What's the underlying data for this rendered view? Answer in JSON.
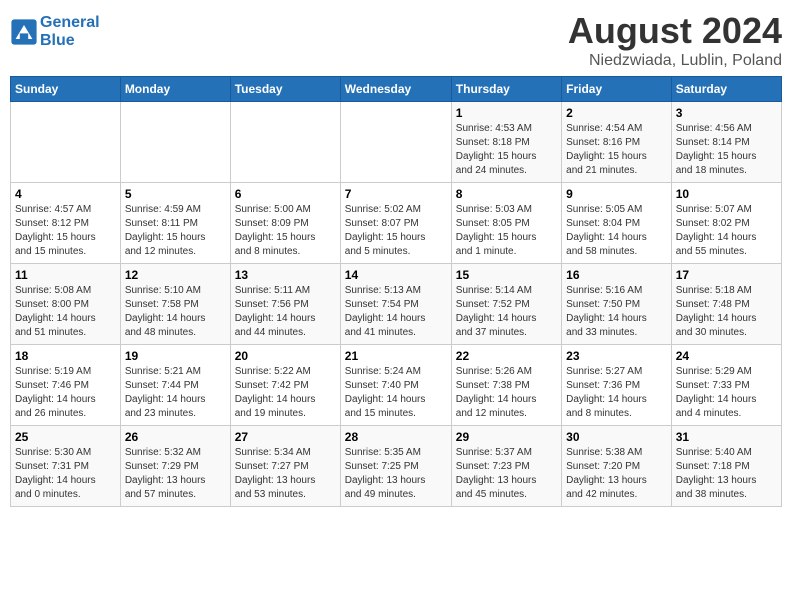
{
  "logo": {
    "line1": "General",
    "line2": "Blue"
  },
  "title": "August 2024",
  "subtitle": "Niedzwiada, Lublin, Poland",
  "header_days": [
    "Sunday",
    "Monday",
    "Tuesday",
    "Wednesday",
    "Thursday",
    "Friday",
    "Saturday"
  ],
  "weeks": [
    [
      {
        "num": "",
        "info": ""
      },
      {
        "num": "",
        "info": ""
      },
      {
        "num": "",
        "info": ""
      },
      {
        "num": "",
        "info": ""
      },
      {
        "num": "1",
        "info": "Sunrise: 4:53 AM\nSunset: 8:18 PM\nDaylight: 15 hours\nand 24 minutes."
      },
      {
        "num": "2",
        "info": "Sunrise: 4:54 AM\nSunset: 8:16 PM\nDaylight: 15 hours\nand 21 minutes."
      },
      {
        "num": "3",
        "info": "Sunrise: 4:56 AM\nSunset: 8:14 PM\nDaylight: 15 hours\nand 18 minutes."
      }
    ],
    [
      {
        "num": "4",
        "info": "Sunrise: 4:57 AM\nSunset: 8:12 PM\nDaylight: 15 hours\nand 15 minutes."
      },
      {
        "num": "5",
        "info": "Sunrise: 4:59 AM\nSunset: 8:11 PM\nDaylight: 15 hours\nand 12 minutes."
      },
      {
        "num": "6",
        "info": "Sunrise: 5:00 AM\nSunset: 8:09 PM\nDaylight: 15 hours\nand 8 minutes."
      },
      {
        "num": "7",
        "info": "Sunrise: 5:02 AM\nSunset: 8:07 PM\nDaylight: 15 hours\nand 5 minutes."
      },
      {
        "num": "8",
        "info": "Sunrise: 5:03 AM\nSunset: 8:05 PM\nDaylight: 15 hours\nand 1 minute."
      },
      {
        "num": "9",
        "info": "Sunrise: 5:05 AM\nSunset: 8:04 PM\nDaylight: 14 hours\nand 58 minutes."
      },
      {
        "num": "10",
        "info": "Sunrise: 5:07 AM\nSunset: 8:02 PM\nDaylight: 14 hours\nand 55 minutes."
      }
    ],
    [
      {
        "num": "11",
        "info": "Sunrise: 5:08 AM\nSunset: 8:00 PM\nDaylight: 14 hours\nand 51 minutes."
      },
      {
        "num": "12",
        "info": "Sunrise: 5:10 AM\nSunset: 7:58 PM\nDaylight: 14 hours\nand 48 minutes."
      },
      {
        "num": "13",
        "info": "Sunrise: 5:11 AM\nSunset: 7:56 PM\nDaylight: 14 hours\nand 44 minutes."
      },
      {
        "num": "14",
        "info": "Sunrise: 5:13 AM\nSunset: 7:54 PM\nDaylight: 14 hours\nand 41 minutes."
      },
      {
        "num": "15",
        "info": "Sunrise: 5:14 AM\nSunset: 7:52 PM\nDaylight: 14 hours\nand 37 minutes."
      },
      {
        "num": "16",
        "info": "Sunrise: 5:16 AM\nSunset: 7:50 PM\nDaylight: 14 hours\nand 33 minutes."
      },
      {
        "num": "17",
        "info": "Sunrise: 5:18 AM\nSunset: 7:48 PM\nDaylight: 14 hours\nand 30 minutes."
      }
    ],
    [
      {
        "num": "18",
        "info": "Sunrise: 5:19 AM\nSunset: 7:46 PM\nDaylight: 14 hours\nand 26 minutes."
      },
      {
        "num": "19",
        "info": "Sunrise: 5:21 AM\nSunset: 7:44 PM\nDaylight: 14 hours\nand 23 minutes."
      },
      {
        "num": "20",
        "info": "Sunrise: 5:22 AM\nSunset: 7:42 PM\nDaylight: 14 hours\nand 19 minutes."
      },
      {
        "num": "21",
        "info": "Sunrise: 5:24 AM\nSunset: 7:40 PM\nDaylight: 14 hours\nand 15 minutes."
      },
      {
        "num": "22",
        "info": "Sunrise: 5:26 AM\nSunset: 7:38 PM\nDaylight: 14 hours\nand 12 minutes."
      },
      {
        "num": "23",
        "info": "Sunrise: 5:27 AM\nSunset: 7:36 PM\nDaylight: 14 hours\nand 8 minutes."
      },
      {
        "num": "24",
        "info": "Sunrise: 5:29 AM\nSunset: 7:33 PM\nDaylight: 14 hours\nand 4 minutes."
      }
    ],
    [
      {
        "num": "25",
        "info": "Sunrise: 5:30 AM\nSunset: 7:31 PM\nDaylight: 14 hours\nand 0 minutes."
      },
      {
        "num": "26",
        "info": "Sunrise: 5:32 AM\nSunset: 7:29 PM\nDaylight: 13 hours\nand 57 minutes."
      },
      {
        "num": "27",
        "info": "Sunrise: 5:34 AM\nSunset: 7:27 PM\nDaylight: 13 hours\nand 53 minutes."
      },
      {
        "num": "28",
        "info": "Sunrise: 5:35 AM\nSunset: 7:25 PM\nDaylight: 13 hours\nand 49 minutes."
      },
      {
        "num": "29",
        "info": "Sunrise: 5:37 AM\nSunset: 7:23 PM\nDaylight: 13 hours\nand 45 minutes."
      },
      {
        "num": "30",
        "info": "Sunrise: 5:38 AM\nSunset: 7:20 PM\nDaylight: 13 hours\nand 42 minutes."
      },
      {
        "num": "31",
        "info": "Sunrise: 5:40 AM\nSunset: 7:18 PM\nDaylight: 13 hours\nand 38 minutes."
      }
    ]
  ]
}
